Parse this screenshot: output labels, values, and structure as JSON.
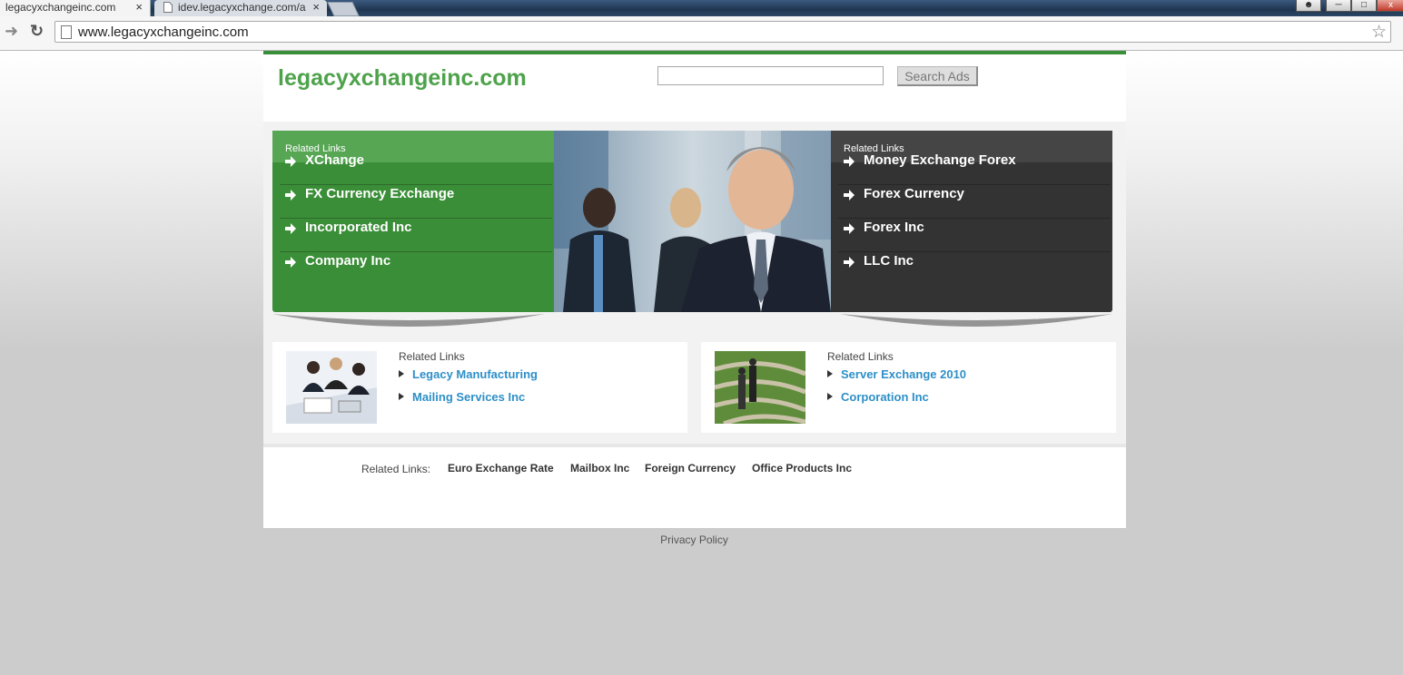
{
  "browser": {
    "tabs": [
      {
        "title": "legacyxchangeinc.com",
        "active": true
      },
      {
        "title": "idev.legacyxchange.com/a",
        "active": false
      }
    ],
    "url": "www.legacyxchangeinc.com",
    "window_controls": [
      "user",
      "minimize",
      "maximize",
      "close"
    ]
  },
  "header": {
    "site_title": "legacyxchangeinc.com",
    "search_value": "",
    "search_button": "Search Ads"
  },
  "hero": {
    "left": {
      "heading": "Related Links",
      "links": [
        "XChange",
        "FX Currency Exchange",
        "Incorporated Inc",
        "Company Inc"
      ]
    },
    "right": {
      "heading": "Related Links",
      "links": [
        "Money Exchange Forex",
        "Forex Currency",
        "Forex Inc",
        "LLC Inc"
      ]
    }
  },
  "boxes": [
    {
      "heading": "Related Links",
      "links": [
        "Legacy Manufacturing",
        "Mailing Services Inc"
      ],
      "image": "business-meeting-photo"
    },
    {
      "heading": "Related Links",
      "links": [
        "Server Exchange 2010",
        "Corporation Inc"
      ],
      "image": "maze-businessmen-photo"
    }
  ],
  "footer": {
    "label": "Related Links:",
    "links": [
      "Euro Exchange Rate",
      "Mailbox Inc",
      "Foreign Currency",
      "Office Products Inc"
    ],
    "privacy": "Privacy Policy"
  },
  "colors": {
    "brand_green": "#4ea24b",
    "panel_green": "#3b8e38",
    "panel_dark": "#333333",
    "link_blue": "#2d8fc8"
  }
}
